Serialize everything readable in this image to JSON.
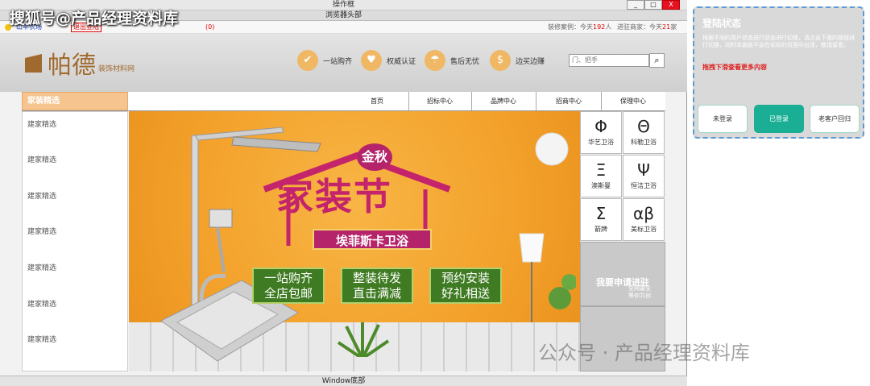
{
  "window": {
    "title": "操作框",
    "min": "_",
    "max": "□",
    "close": "X"
  },
  "browser": {
    "head": "浏览器头部"
  },
  "topbar": {
    "welcome": "山羊农场",
    "logout": "退出登陆",
    "count": "(0)",
    "stats_label1": "装修案例：今天",
    "stats_val1": "192",
    "stats_unit1": "人",
    "stats_label2": "进驻商家：今天",
    "stats_val2": "21",
    "stats_unit2": "家"
  },
  "watermark": {
    "top": "搜狐号@产品经理资料库",
    "bottom": "公众号 · 产品经理资料库"
  },
  "logo": {
    "name": "帕德",
    "sub": "装饰材料网"
  },
  "features": [
    {
      "icon": "✔",
      "label": "一站购齐"
    },
    {
      "icon": "♥",
      "label": "权威认证"
    },
    {
      "icon": "☂",
      "label": "售后无忧"
    },
    {
      "icon": "$",
      "label": "边买边赚"
    }
  ],
  "search": {
    "placeholder": "门、把手",
    "icon": "🔍"
  },
  "nav": {
    "category": "家装精选",
    "items": [
      "首页",
      "招标中心",
      "品牌中心",
      "招商中心",
      "保理中心"
    ]
  },
  "sidebar": [
    "建家精选",
    "建家精选",
    "建家精选",
    "建家精选",
    "建家精选",
    "建家精选",
    "建家精选"
  ],
  "banner": {
    "gold": "金秋",
    "title": "家装节",
    "ribbon": "埃菲斯卡卫浴",
    "promos": [
      [
        "一站购齐",
        "全店包邮"
      ],
      [
        "整装待发",
        "直击满减"
      ],
      [
        "预约安装",
        "好礼相送"
      ]
    ]
  },
  "brands": [
    {
      "sym": "Φ",
      "label": "华艺卫浴"
    },
    {
      "sym": "Θ",
      "label": "科勒卫浴"
    },
    {
      "sym": "Ξ",
      "label": "澳斯曼"
    },
    {
      "sym": "Ψ",
      "label": "恒洁卫浴"
    },
    {
      "sym": "Σ",
      "label": "箭牌"
    },
    {
      "sym": "αβ",
      "label": "美标卫浴"
    }
  ],
  "apply": {
    "title": "我要申请进驻",
    "sub1": "全网最全",
    "sub2": "等你共创"
  },
  "footer": {
    "label": "Window底部"
  },
  "panel": {
    "title": "登陆状态",
    "desc": "根据不同的用户状态进行状态进行切换，请点击下面的按钮进行切换，同时本面板不会在实际的页面中出现，敬请留意。",
    "hint": "拖拽下滑查看更多内容",
    "buttons": [
      "未登录",
      "已登录",
      "老客户回归"
    ],
    "active": 1
  },
  "colors": {
    "accent": "#f0b764",
    "brand": "#a06a2e",
    "banner": "#f3a22c",
    "promo": "#3f7b22",
    "panel_active": "#1aaf95"
  }
}
